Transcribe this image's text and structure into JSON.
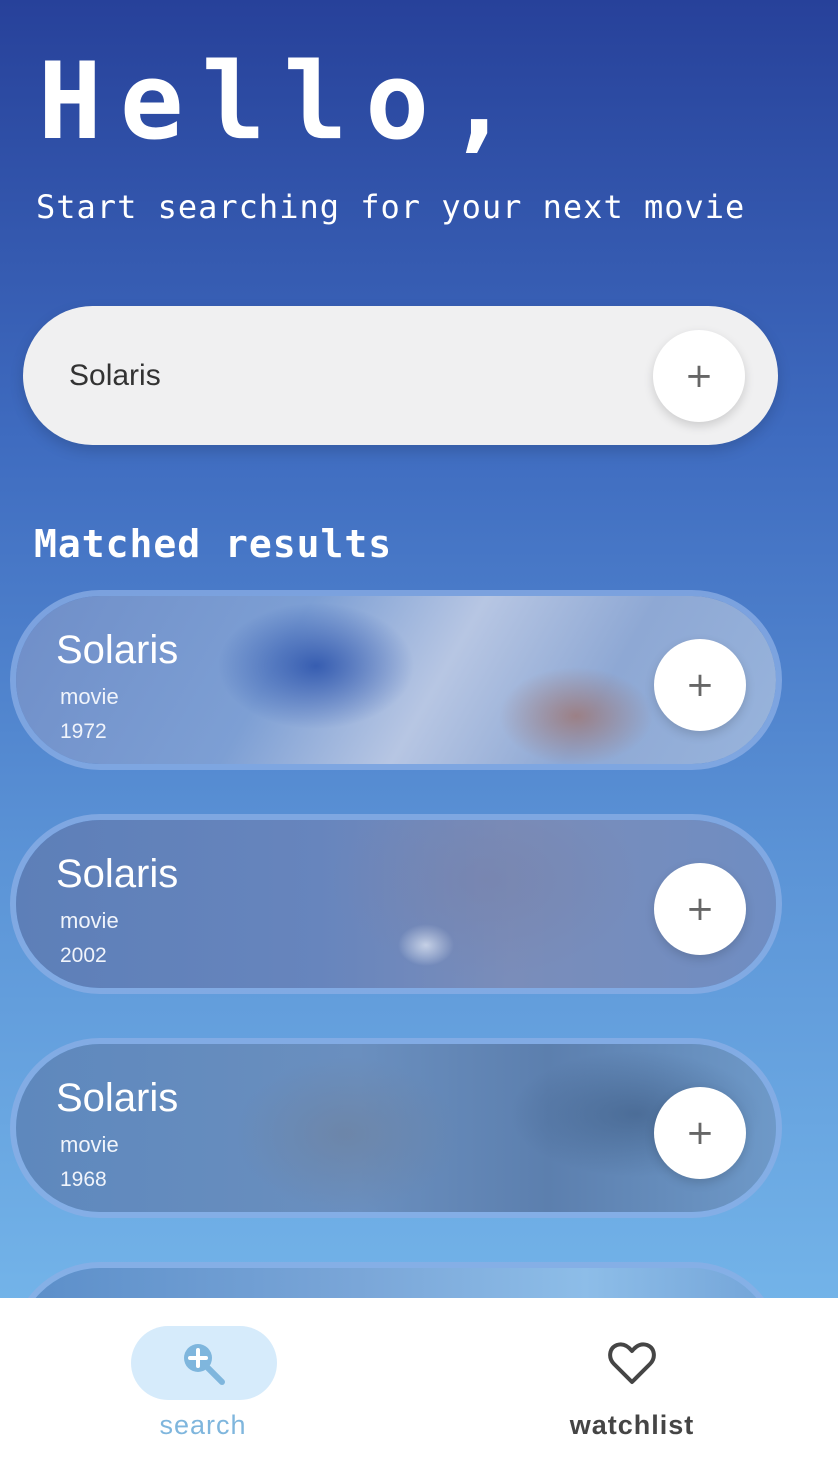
{
  "header": {
    "greeting": "Hello,",
    "subtitle": "Start searching for your next movie"
  },
  "search": {
    "value": "Solaris",
    "add_icon": "plus-icon",
    "add_label": "+"
  },
  "results": {
    "title": "Matched results",
    "items": [
      {
        "title": "Solaris",
        "type": "movie",
        "year": "1972",
        "add_label": "+"
      },
      {
        "title": "Solaris",
        "type": "movie",
        "year": "2002",
        "add_label": "+"
      },
      {
        "title": "Solaris",
        "type": "movie",
        "year": "1968",
        "add_label": "+"
      },
      {
        "title": "",
        "type": "",
        "year": "",
        "add_label": ""
      }
    ]
  },
  "nav": {
    "items": [
      {
        "label": "search",
        "icon": "search-plus-icon",
        "active": true
      },
      {
        "label": "watchlist",
        "icon": "heart-icon",
        "active": false
      }
    ]
  },
  "colors": {
    "gradient_top": "#27419a",
    "gradient_bottom": "#7cc0f0",
    "active_nav": "#7fb6dd",
    "active_pill": "#d6ebfb",
    "inactive_nav": "#454545"
  }
}
